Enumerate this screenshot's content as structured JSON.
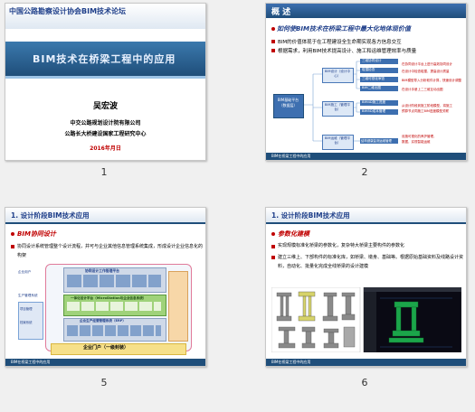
{
  "slides": [
    {
      "number": "1",
      "header": "中国公路勘察设计协会BIM技术论坛",
      "title": "BIM技术在桥梁工程中的应用",
      "author": "吴宏波",
      "org": "中交公路规划设计院有限公司",
      "center": "公路长大桥建设国家工程研究中心",
      "date": "2016年月日"
    },
    {
      "number": "2",
      "heading": "概 述",
      "subheading": "如何使BIM技术在桥梁工程中最大化地体现价值",
      "bullets": [
        "BIM的价值体现于在工程建设全生命期实现各方信息交互",
        "根据需求，利用BIM技术提高设计、施工和运维管理效率与质量"
      ],
      "platform_label": "BIM基础平台（数据层）",
      "branches": [
        "BIM设计（设计中心）",
        "BIM施工（管理平台）",
        "BIM运维（管理平台）"
      ],
      "design_items": [
        "三维协同设计",
        "碰撞检查",
        "三维可视化审查",
        "BIM二维出图"
      ],
      "construction_items": [
        "BIM4D施工进度",
        "BIM5D成本管理"
      ],
      "ops_items": [
        "结构健康监测运维管理"
      ],
      "footer": "BIM在桥梁工程中的应用"
    },
    {
      "number": "5",
      "heading": "1. 设计阶段BIM技术应用",
      "subheading": "BIM协同设计",
      "bullets": [
        "协同设计系统管理整个设计流程，并可与企业其他信息管理系统集成，形成设计企业信息化的构架"
      ],
      "diagram_top": "协同设计工作管理平台",
      "diagram_middle": "一体化设计平台（MicroStation与企业信息系统）",
      "diagram_bottom": "企业生产经营管理系统（ERP）",
      "side_labels": [
        "企业用户",
        "生产管理系统",
        "项目管理",
        "档案系统"
      ],
      "portal": "企业门户（一级封装）",
      "footer": "BIM在桥梁工程中的应用"
    },
    {
      "number": "6",
      "heading": "1. 设计阶段BIM技术应用",
      "subheading": "参数化建模",
      "bullets": [
        "实现规模标准化桥梁的参数化，复杂特大桥梁主要构件的参数化",
        "建立三维上、下部构件的标准化库，如桥梁、墩身、基础等。根据原始基础资料及线路设计资料，自动化、批量化完成全线桥梁的设计建模"
      ],
      "footer": "BIM在桥梁工程中的应用"
    }
  ]
}
